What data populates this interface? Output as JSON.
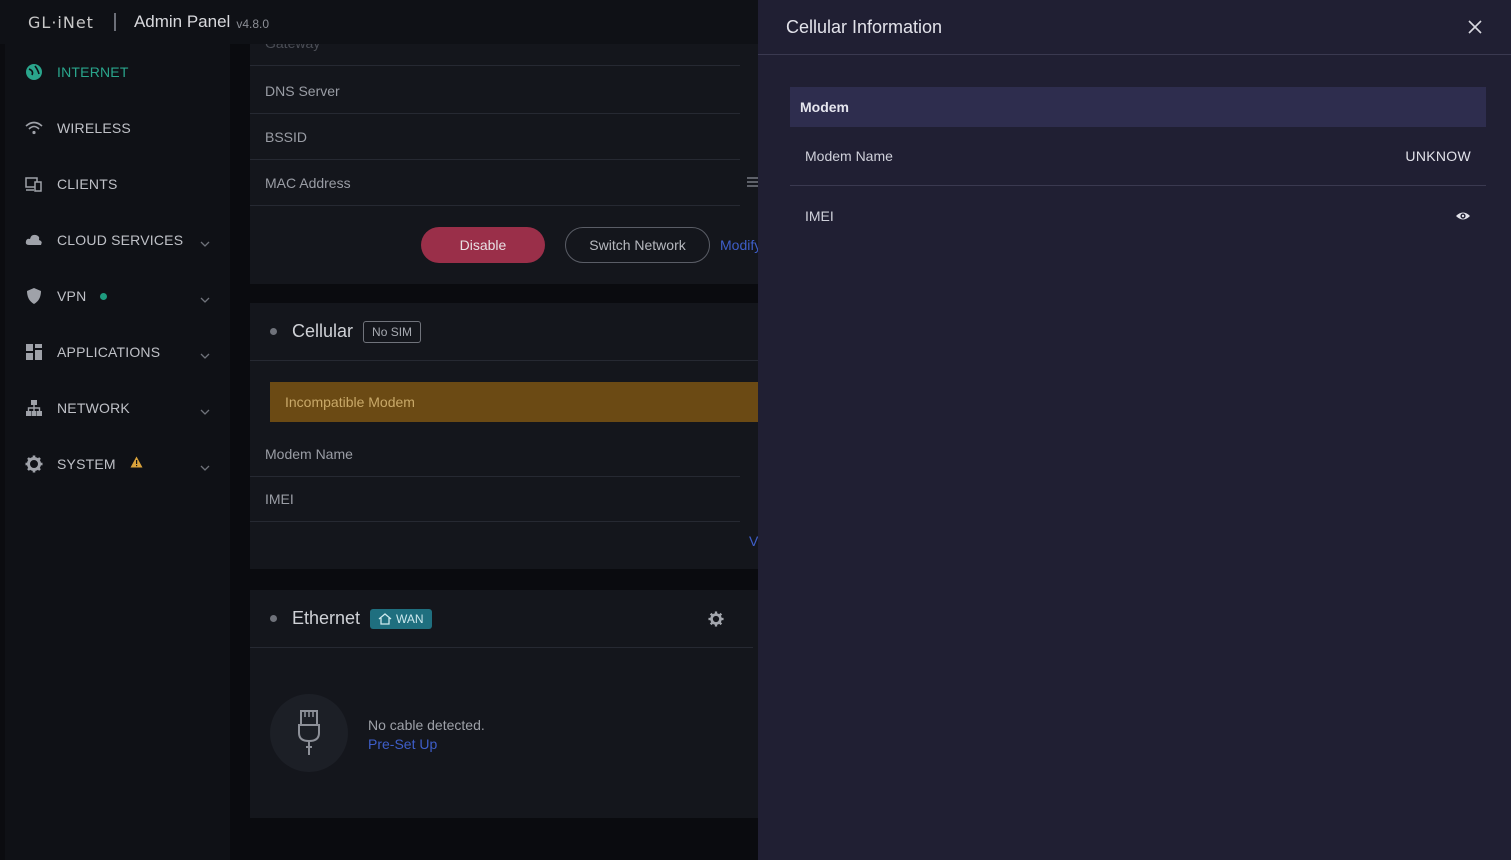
{
  "header": {
    "logo": "GL·iNet",
    "title": "Admin Panel",
    "version": "v4.8.0"
  },
  "sidebar": {
    "items": [
      {
        "label": "INTERNET",
        "icon": "globe-icon",
        "active": true
      },
      {
        "label": "WIRELESS",
        "icon": "wifi-icon"
      },
      {
        "label": "CLIENTS",
        "icon": "devices-icon"
      },
      {
        "label": "CLOUD SERVICES",
        "icon": "cloud-icon",
        "expandable": true
      },
      {
        "label": "VPN",
        "icon": "shield-icon",
        "expandable": true,
        "status": "green-dot"
      },
      {
        "label": "APPLICATIONS",
        "icon": "apps-grid-icon",
        "expandable": true
      },
      {
        "label": "NETWORK",
        "icon": "network-icon",
        "expandable": true
      },
      {
        "label": "SYSTEM",
        "icon": "gear-icon",
        "expandable": true,
        "status": "warning-icon"
      }
    ]
  },
  "repeater": {
    "rows": [
      "Gateway",
      "DNS Server",
      "BSSID",
      "MAC Address"
    ],
    "disable_label": "Disable",
    "switch_label": "Switch Network",
    "modify_label": "Modify"
  },
  "cellular": {
    "title": "Cellular",
    "badge": "No SIM",
    "warning": "Incompatible Modem",
    "rows": [
      "Modem Name",
      "IMEI"
    ],
    "link": "V"
  },
  "ethernet": {
    "title": "Ethernet",
    "badge": "WAN",
    "status": "No cable detected.",
    "link": "Pre-Set Up"
  },
  "panel": {
    "title": "Cellular Information",
    "section": "Modem",
    "modem_name_label": "Modem Name",
    "modem_name_value": "UNKNOW",
    "imei_label": "IMEI"
  },
  "colors": {
    "accent": "#2aa58c",
    "danger": "#9a2f49",
    "link": "#3e5ec9",
    "panel_bg": "#201f33"
  }
}
